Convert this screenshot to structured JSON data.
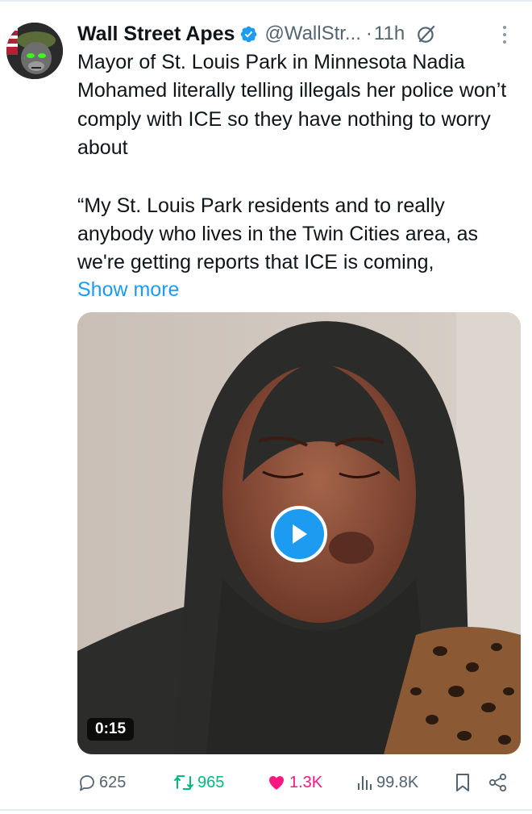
{
  "tweet": {
    "author": {
      "name": "Wall Street Apes",
      "handle": "@WallStr...",
      "verified": true
    },
    "separator": "·",
    "time": "11h",
    "text_paragraphs": [
      "Mayor of St. Louis Park in Minnesota Nadia Mohamed literally telling illegals her police won’t comply with ICE so they have nothing to worry about",
      "“My St. Louis Park residents and to really anybody who lives in the Twin Cities area, as we're getting reports that ICE is coming,"
    ],
    "show_more": "Show more",
    "media": {
      "type": "video",
      "duration": "0:15"
    },
    "metrics": {
      "replies": "625",
      "reposts": "965",
      "likes": "1.3K",
      "views": "99.8K"
    }
  },
  "colors": {
    "accent": "#1d9bf0",
    "repost": "#00ba7c",
    "like": "#f91880",
    "muted": "#536471"
  },
  "icons": [
    "verified-badge-icon",
    "grok-icon",
    "more-options-icon",
    "play-icon",
    "reply-icon",
    "repost-icon",
    "like-icon",
    "views-icon",
    "bookmark-icon",
    "share-icon"
  ]
}
